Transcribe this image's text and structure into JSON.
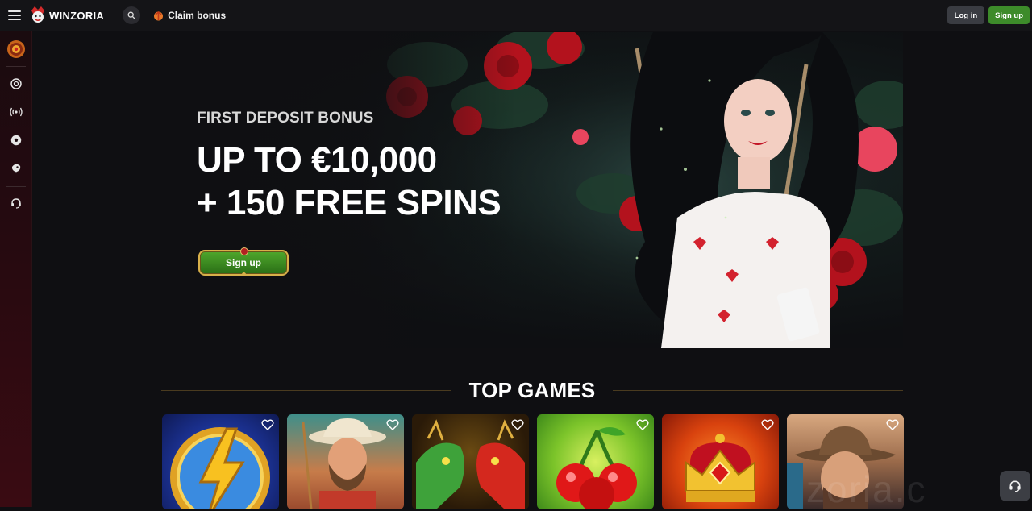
{
  "header": {
    "logo_text": "WINZORIA",
    "claim_label": "Claim bonus",
    "login_label": "Log in",
    "signup_label": "Sign up"
  },
  "sidebar": {
    "items": [
      {
        "icon": "bonus-wheel-icon"
      },
      {
        "icon": "casino-chip-icon"
      },
      {
        "icon": "live-broadcast-icon"
      },
      {
        "icon": "soccer-ball-icon"
      },
      {
        "icon": "esports-icon"
      },
      {
        "icon": "support-headset-icon"
      }
    ]
  },
  "hero": {
    "subtitle": "FIRST DEPOSIT BONUS",
    "title_line1": "UP TO €10,000",
    "title_line2": "+ 150 FREE SPINS",
    "cta_label": "Sign up"
  },
  "top_games": {
    "title": "TOP GAMES",
    "games": [
      {
        "theme": "lightning-coin"
      },
      {
        "theme": "fisherman-cowboy"
      },
      {
        "theme": "dragons"
      },
      {
        "theme": "cherries"
      },
      {
        "theme": "crown"
      },
      {
        "theme": "cowboy"
      }
    ]
  },
  "watermark": "zoria.c",
  "colors": {
    "background": "#0f0f12",
    "signup_green": "#3d8b2a",
    "gold_accent": "#d8b04a",
    "sidebar_red": "#3a0b12"
  }
}
